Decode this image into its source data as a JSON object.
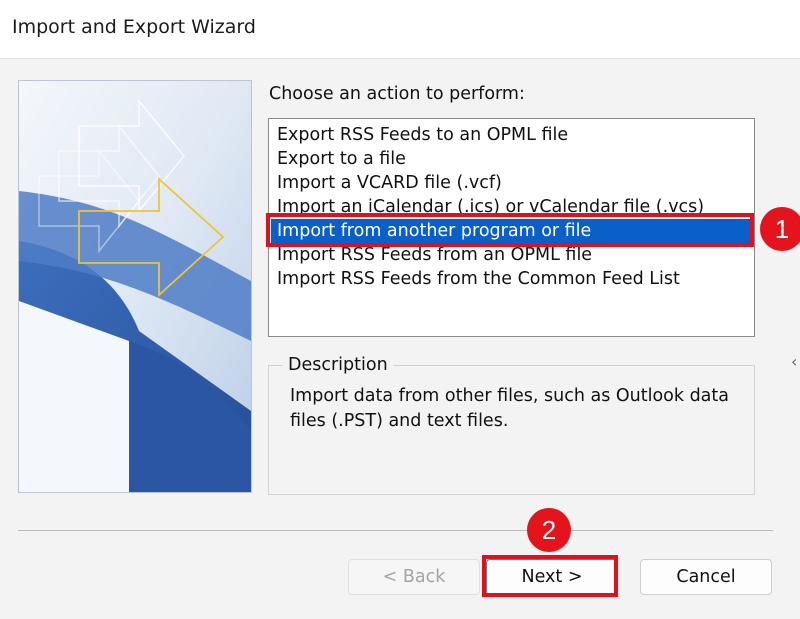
{
  "window": {
    "title": "Import and Export Wizard"
  },
  "action_list": {
    "label": "Choose an action to perform:",
    "items": [
      {
        "label": "Export RSS Feeds to an OPML file",
        "selected": false
      },
      {
        "label": "Export to a file",
        "selected": false
      },
      {
        "label": "Import a VCARD file (.vcf)",
        "selected": false
      },
      {
        "label": "Import an iCalendar (.ics) or vCalendar file (.vcs)",
        "selected": false
      },
      {
        "label": "Import from another program or file",
        "selected": true
      },
      {
        "label": "Import RSS Feeds from an OPML file",
        "selected": false
      },
      {
        "label": "Import RSS Feeds from the Common Feed List",
        "selected": false
      }
    ]
  },
  "description": {
    "legend": "Description",
    "text": "Import data from other files, such as Outlook data files (.PST) and text files."
  },
  "buttons": {
    "back": "< Back",
    "next": "Next >",
    "cancel": "Cancel"
  },
  "annotations": {
    "step_1": "1",
    "step_2": "2",
    "color": "#e3141b"
  },
  "colors": {
    "selection": "#0a5fc8",
    "art_blue": "#2f5fae",
    "arrow_yellow": "#f0c430"
  }
}
